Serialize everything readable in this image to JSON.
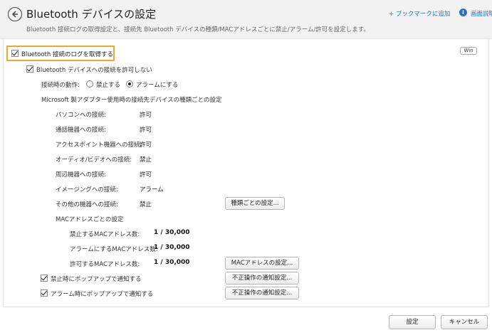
{
  "header": {
    "title": "Bluetooth デバイスの設定",
    "subtitle": "Bluetooth 接続ログの取得設定と、接続先 Bluetooth デバイスの種類/MACアドレスごとに禁止/アラーム/許可を設定します。",
    "bookmark_link": "+ ブックマークに追加",
    "help_link": "画面説明",
    "os_badge": "Win"
  },
  "settings": {
    "log_checkbox_label": "Bluetooth 接続のログを取得する",
    "disallow_label": "Bluetooth デバイスへの接続を許可しない",
    "action_label": "接続時の動作:",
    "radio_prohibit": "禁止する",
    "radio_alarm": "アラームにする",
    "adapter_section": "Microsoft 製アダプター使用時の接続先デバイスの種類ごとの設定",
    "device_types": [
      {
        "label": "パソコンへの接続:",
        "value": "許可"
      },
      {
        "label": "通話機器への接続:",
        "value": "許可"
      },
      {
        "label": "アクセスポイント機器への接続:",
        "value": "許可"
      },
      {
        "label": "オーディオ/ビデオへの接続:",
        "value": "禁止"
      },
      {
        "label": "周辺機器への接続:",
        "value": "許可"
      },
      {
        "label": "イメージングへの接続:",
        "value": "アラーム"
      },
      {
        "label": "その他の機器への接続:",
        "value": "禁止"
      }
    ],
    "type_settings_button": "種類ごとの設定...",
    "mac_section": "MACアドレスごとの設定",
    "mac_counts": [
      {
        "label": "禁止するMACアドレス数:",
        "value": "1 / 30,000"
      },
      {
        "label": "アラームにするMACアドレス数:",
        "value": "1 / 30,000"
      },
      {
        "label": "許可するMACアドレス数:",
        "value": "1 / 30,000"
      }
    ],
    "mac_settings_button": "MACアドレスの設定...",
    "popup_prohibit_label": "禁止時にポップアップで通知する",
    "popup_alarm_label": "アラーム時にポップアップで通知する",
    "notify_button_1": "不正操作の通知設定...",
    "notify_button_2": "不正操作の通知設定..."
  },
  "footer": {
    "ok_button": "設定",
    "cancel_button": "キャンセル"
  },
  "colors": {
    "highlight": "#f0a830",
    "link": "#2a6fc9",
    "header_bg": "#f2f2f2"
  }
}
